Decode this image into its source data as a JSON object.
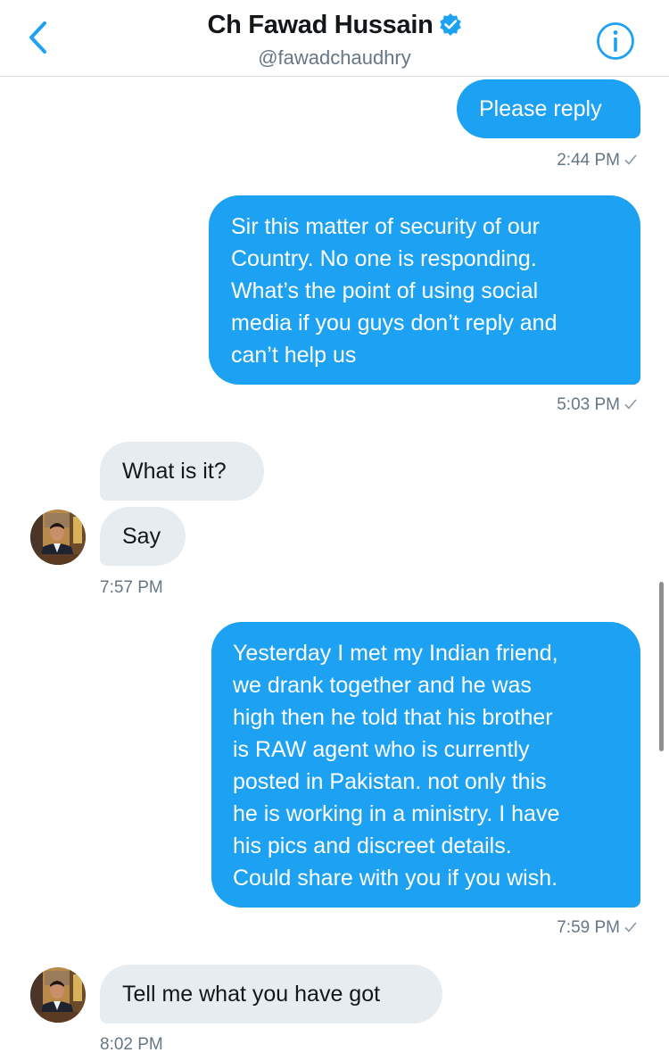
{
  "header": {
    "name": "Ch Fawad Hussain",
    "handle": "@fawadchaudhry",
    "back_icon": "chevron-left-icon",
    "verified_icon": "verified-badge-icon",
    "info_icon": "info-icon",
    "accent": "#1da1f2"
  },
  "conversation": {
    "messages": [
      {
        "direction": "outgoing",
        "lines": [
          "Please reply"
        ],
        "time": "2:44 PM"
      },
      {
        "direction": "outgoing",
        "lines": [
          "Sir this matter of security of our",
          "Country. No one is responding.",
          "What’s the point of using social",
          "media if you guys don’t reply and",
          "can’t help us"
        ],
        "time": "5:03 PM"
      },
      {
        "direction": "incoming",
        "lines": [
          "What is it?"
        ]
      },
      {
        "direction": "incoming",
        "lines": [
          "Say"
        ],
        "time": "7:57 PM"
      },
      {
        "direction": "outgoing",
        "lines": [
          "Yesterday I met my Indian friend,",
          "we drank together and he was",
          "high then he told that his brother",
          "is RAW agent who is currently",
          "posted in Pakistan. not only this",
          "he is working in a ministry. I have",
          "his pics and discreet details.",
          "Could share with you if you wish."
        ],
        "time": "7:59 PM"
      },
      {
        "direction": "incoming",
        "lines": [
          "Tell me what you have got"
        ],
        "time": "8:02 PM"
      }
    ]
  },
  "colors": {
    "outgoing_bubble": "#1da1f2",
    "incoming_bubble": "#e6ecf0",
    "timestamp": "#657786"
  }
}
